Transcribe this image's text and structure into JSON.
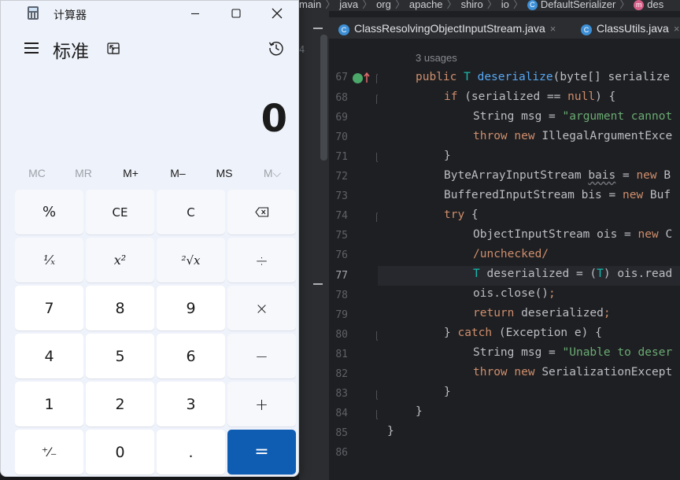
{
  "ide": {
    "breadcrumb": [
      "main",
      "java",
      "org",
      "apache",
      "shiro",
      "io",
      "DefaultSerializer",
      "des"
    ],
    "tabs": [
      {
        "label": "ClassResolvingObjectInputStream.java",
        "close": "×"
      },
      {
        "label": "ClassUtils.java",
        "close": "×"
      }
    ],
    "side_number": "4",
    "usages": "3 usages",
    "line_numbers": [
      "67",
      "68",
      "69",
      "70",
      "71",
      "72",
      "73",
      "74",
      "75",
      "76",
      "77",
      "78",
      "79",
      "80",
      "81",
      "82",
      "83",
      "84",
      "85",
      "86"
    ],
    "current_line": "77",
    "code": {
      "l67": [
        "public",
        "T",
        "deserialize",
        "(byte[] serialize"
      ],
      "l68": [
        "if",
        " (serialized == ",
        "null",
        ") {"
      ],
      "l69": [
        "String msg = ",
        "\"argument cannot"
      ],
      "l70": [
        "throw",
        "new",
        " IllegalArgumentExce"
      ],
      "l71": "}",
      "l72": [
        "ByteArrayInputStream ",
        "bais",
        " = ",
        "new",
        " B"
      ],
      "l73": [
        "BufferedInputStream bis = ",
        "new",
        " Buf"
      ],
      "l74": [
        "try",
        " {"
      ],
      "l75": [
        "ObjectInputStream ois = ",
        "new",
        " C"
      ],
      "l76": "/unchecked/",
      "l77": [
        "T",
        " deserialized = (",
        "T",
        ") ois.read"
      ],
      "l78": [
        "ois.close()",
        ";"
      ],
      "l79": [
        "return",
        " deserialized",
        ";"
      ],
      "l80": [
        "} ",
        "catch",
        " (Exception e) {"
      ],
      "l81": [
        "String msg = ",
        "\"Unable to deser"
      ],
      "l82": [
        "throw",
        "new",
        " SerializationExcept"
      ],
      "l83": "}",
      "l84": "}",
      "l85": "}"
    }
  },
  "calculator": {
    "title": "计算器",
    "mode": "标准",
    "display_value": "0",
    "window_buttons": {
      "minimize": "—",
      "maximize": "☐",
      "close": "✕"
    },
    "memory": [
      {
        "label": "MC",
        "enabled": false
      },
      {
        "label": "MR",
        "enabled": false
      },
      {
        "label": "M+",
        "enabled": true
      },
      {
        "label": "M–",
        "enabled": true
      },
      {
        "label": "MS",
        "enabled": true
      },
      {
        "label": "M⌵",
        "enabled": false
      }
    ],
    "keys": [
      [
        "%",
        "CE",
        "C",
        "⌫"
      ],
      [
        "¹⁄ₓ",
        "x²",
        "²√x",
        "÷"
      ],
      [
        "7",
        "8",
        "9",
        "×"
      ],
      [
        "4",
        "5",
        "6",
        "−"
      ],
      [
        "1",
        "2",
        "3",
        "+"
      ],
      [
        "⁺⁄₋",
        "0",
        ".",
        "="
      ]
    ],
    "colors": {
      "accent": "#0f5cb3",
      "background": "#eef2fa"
    }
  }
}
